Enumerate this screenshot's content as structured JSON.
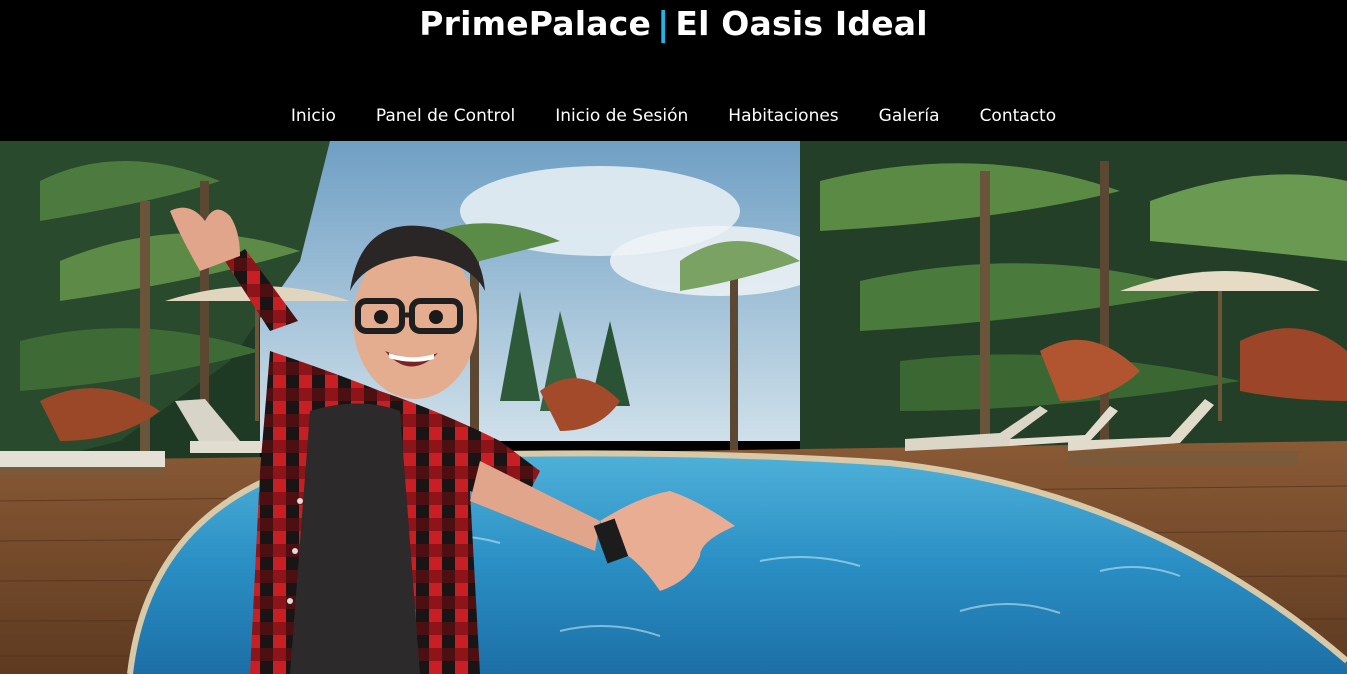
{
  "header": {
    "brand_name": "PrimePalace",
    "brand_separator": "|",
    "brand_tagline": "El Oasis Ideal",
    "accent_color": "#1fb6e8"
  },
  "nav": {
    "items": [
      {
        "label": "Inicio"
      },
      {
        "label": "Panel de Control"
      },
      {
        "label": "Inicio de Sesión"
      },
      {
        "label": "Habitaciones"
      },
      {
        "label": "Galería"
      },
      {
        "label": "Contacto"
      }
    ]
  }
}
